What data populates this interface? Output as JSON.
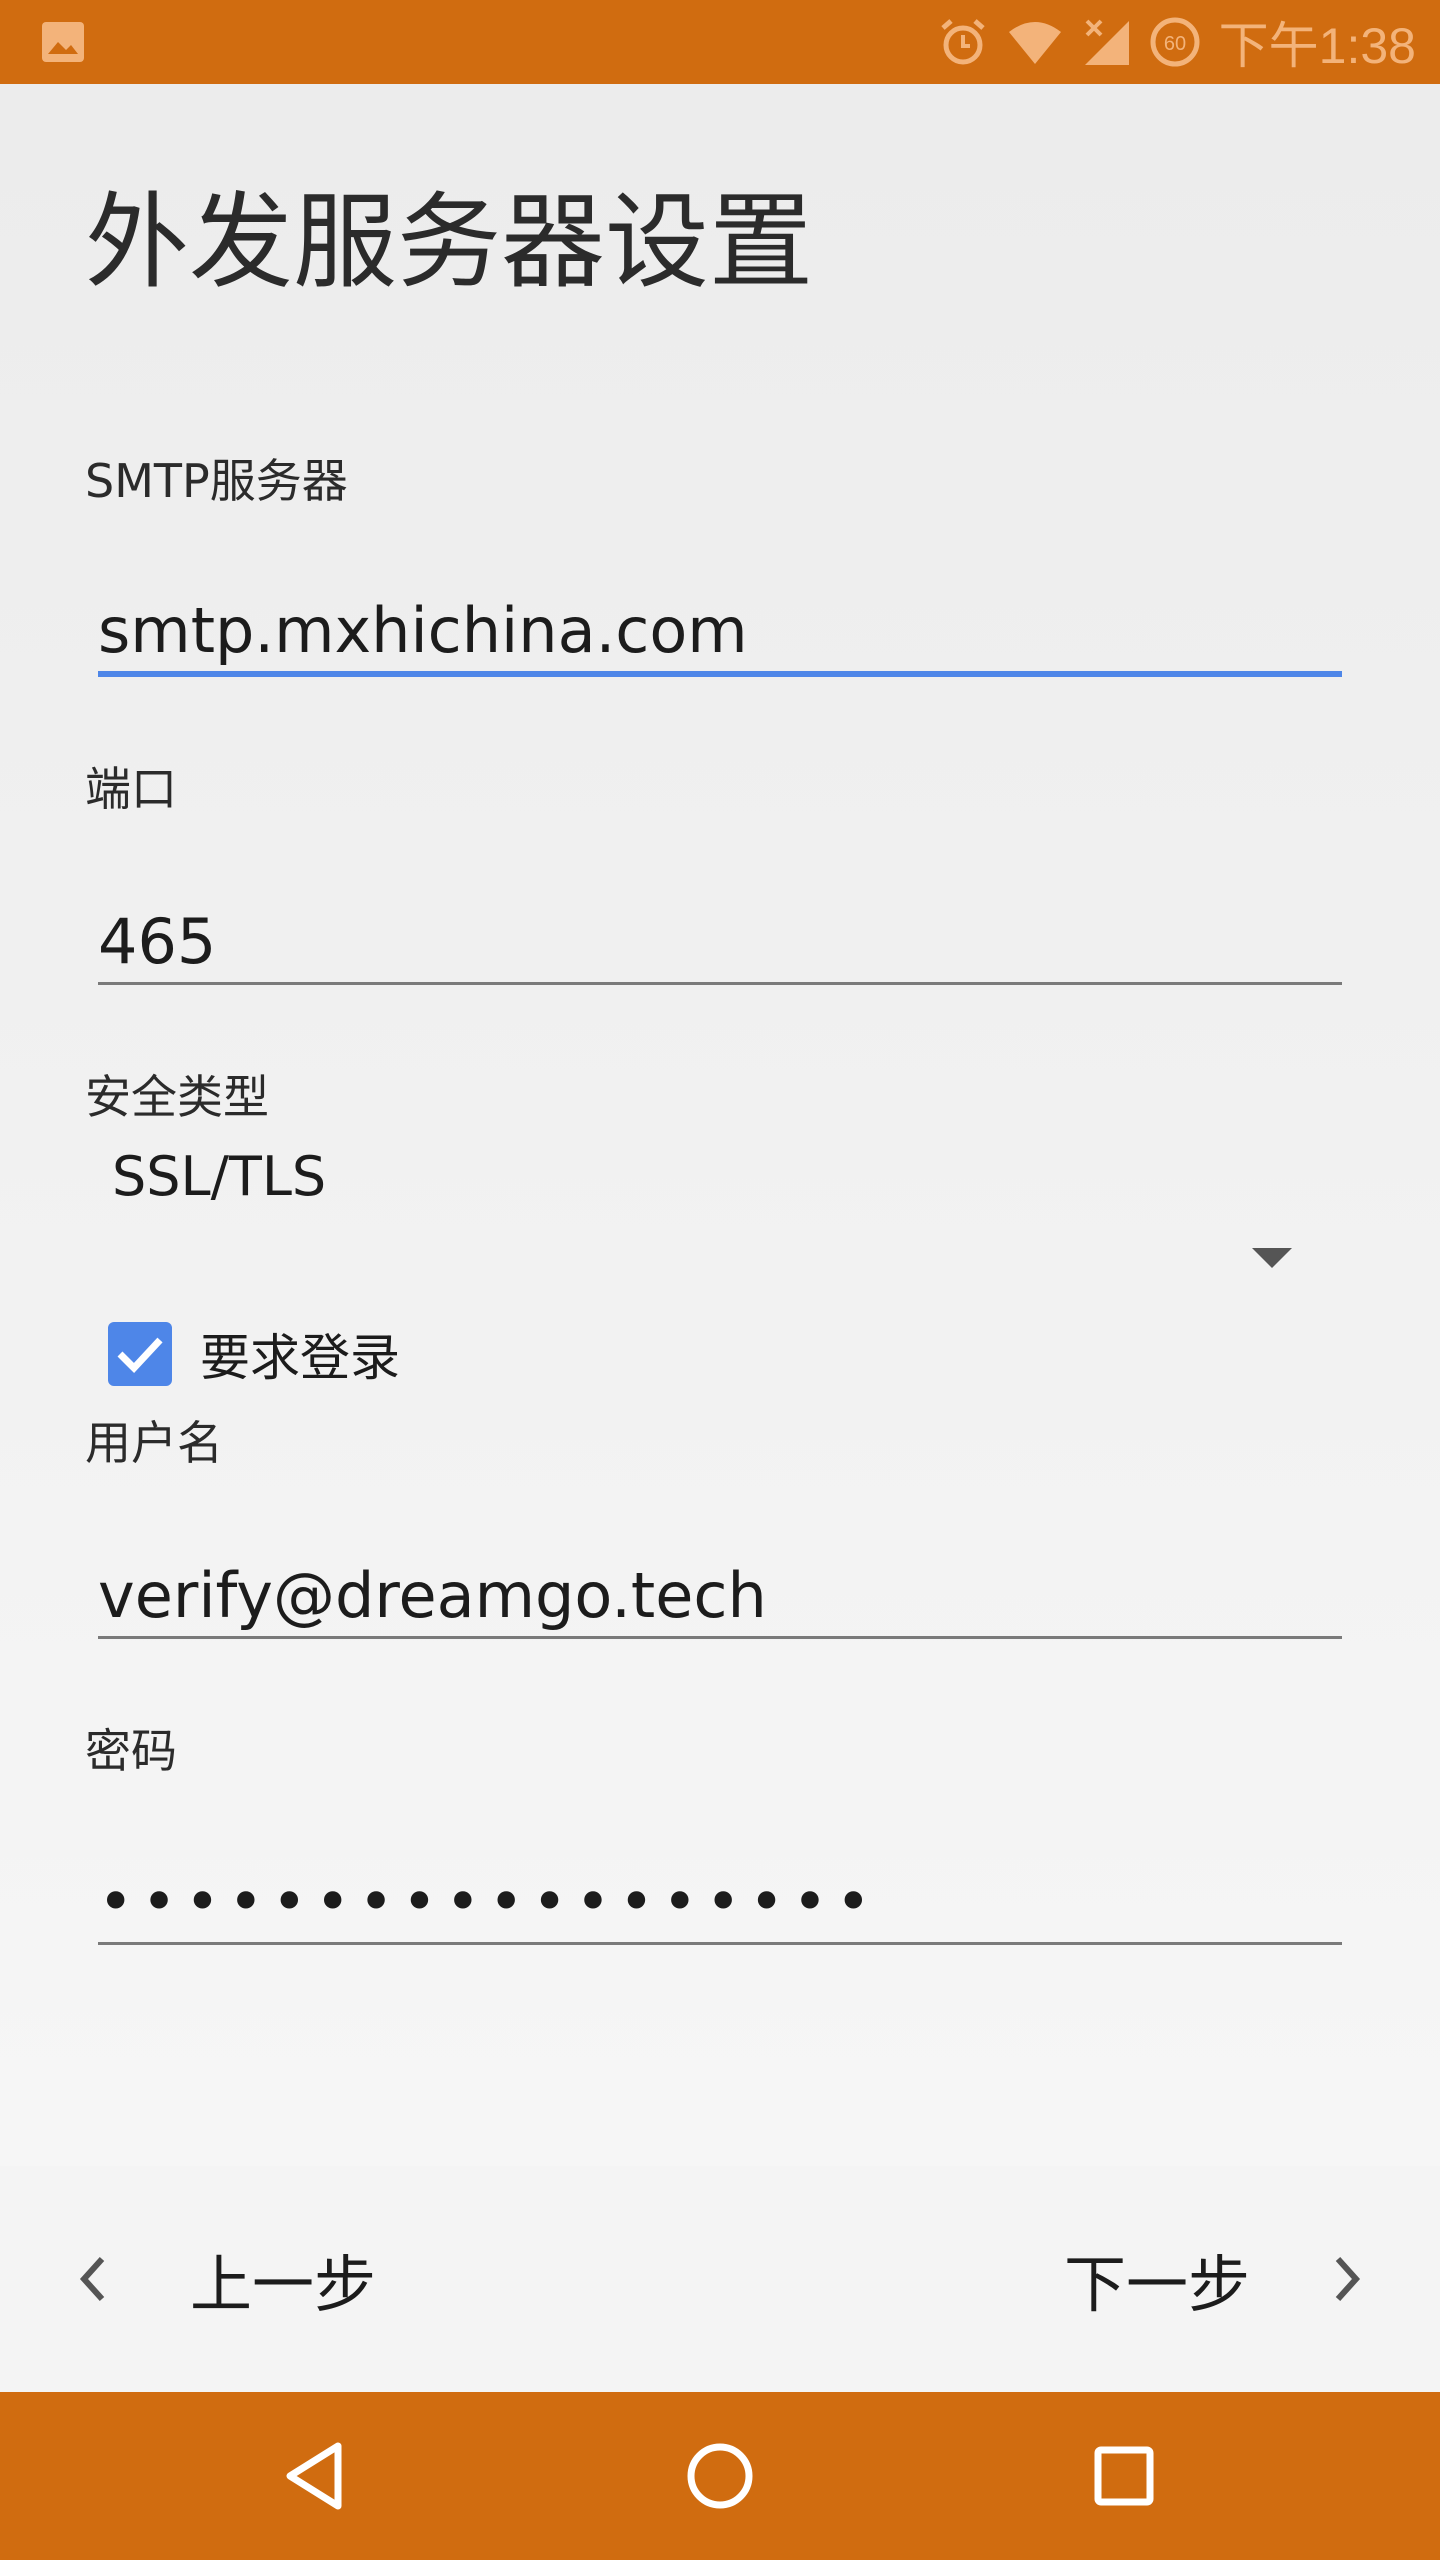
{
  "status_bar": {
    "time": "下午1:38",
    "icons": [
      "gallery-icon",
      "alarm-icon",
      "wifi-icon",
      "signal-icon",
      "battery-saver-icon"
    ]
  },
  "page": {
    "title": "外发服务器设置"
  },
  "smtp_server": {
    "label": "SMTP服务器",
    "value": "smtp.mxhichina.com"
  },
  "port": {
    "label": "端口",
    "value": "465"
  },
  "security_type": {
    "label": "安全类型",
    "value": "SSL/TLS"
  },
  "require_login": {
    "label": "要求登录",
    "checked": true
  },
  "username": {
    "label": "用户名",
    "value": "verify@dreamgo.tech"
  },
  "password": {
    "label": "密码",
    "value": "••••••••••••••••••"
  },
  "footer": {
    "prev_label": "上一步",
    "next_label": "下一步"
  },
  "system_nav": {
    "buttons": [
      "back-icon",
      "home-icon",
      "recents-icon"
    ]
  },
  "colors": {
    "status_bar": "#d06c10",
    "accent": "#4e86e8"
  }
}
